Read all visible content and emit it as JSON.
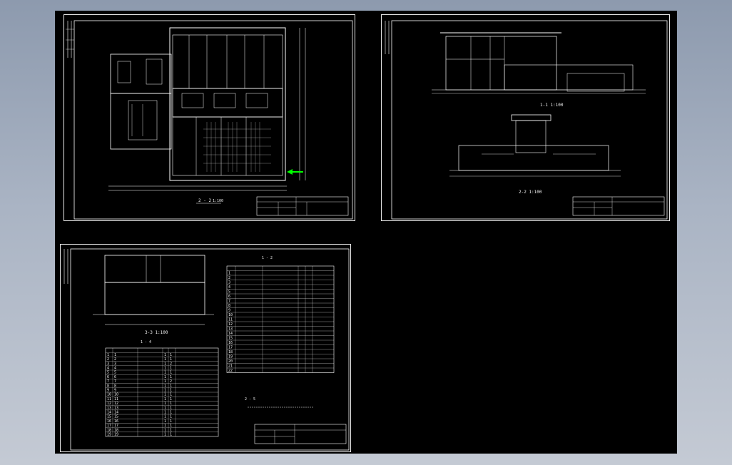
{
  "colors": {
    "background_top": "#8d9aae",
    "background_bottom": "#c4cad4",
    "model_space": "#000000",
    "line_white": "#ffffff",
    "accent_green": "#00ff00"
  },
  "sheets": [
    {
      "title": "2 - 2",
      "scale": "1:100"
    },
    {
      "title": "1-1 1:100",
      "title2": "2-2 1:100"
    },
    {
      "title": "3-3 1:100",
      "list_title_left": "1 - 4",
      "list_title_right": "1 - 2",
      "note": "2 - 5"
    }
  ],
  "table_left": {
    "rows": [
      [
        "1",
        "1",
        "",
        "1",
        "1",
        ""
      ],
      [
        "2",
        "2",
        "",
        "1",
        "1",
        ""
      ],
      [
        "3",
        "3",
        "",
        "1",
        "2",
        ""
      ],
      [
        "4",
        "4",
        "",
        "1",
        "1",
        ""
      ],
      [
        "5",
        "5",
        "",
        "1",
        "1",
        ""
      ],
      [
        "6",
        "6",
        "",
        "1",
        "1",
        ""
      ],
      [
        "7",
        "7",
        "",
        "1",
        "2",
        ""
      ],
      [
        "8",
        "8",
        "",
        "1",
        "1",
        ""
      ],
      [
        "9",
        "9",
        "",
        "1",
        "1",
        ""
      ],
      [
        "10",
        "10",
        "",
        "1",
        "1",
        ""
      ],
      [
        "11",
        "11",
        "",
        "1",
        "1",
        ""
      ],
      [
        "12",
        "12",
        "",
        "1",
        "1",
        ""
      ],
      [
        "13",
        "13",
        "",
        "1",
        "1",
        ""
      ],
      [
        "14",
        "14",
        "",
        "1",
        "1",
        ""
      ],
      [
        "15",
        "15",
        "",
        "1",
        "1",
        ""
      ],
      [
        "16",
        "16",
        "",
        "1",
        "1",
        ""
      ],
      [
        "17",
        "17",
        "",
        "1",
        "1",
        ""
      ],
      [
        "18",
        "18",
        "",
        "1",
        "1",
        ""
      ],
      [
        "19",
        "19",
        "",
        "1",
        "1",
        ""
      ]
    ]
  },
  "table_right": {
    "rows": [
      [
        "1",
        "",
        "",
        "",
        "",
        ""
      ],
      [
        "2",
        "",
        "",
        "",
        "",
        ""
      ],
      [
        "3",
        "",
        "",
        "",
        "",
        ""
      ],
      [
        "4",
        "",
        "",
        "",
        "",
        ""
      ],
      [
        "5",
        "",
        "",
        "",
        "",
        ""
      ],
      [
        "6",
        "",
        "",
        "",
        "",
        ""
      ],
      [
        "7",
        "",
        "",
        "",
        "",
        ""
      ],
      [
        "8",
        "",
        "",
        "",
        "",
        ""
      ],
      [
        "9",
        "",
        "",
        "",
        "",
        ""
      ],
      [
        "10",
        "",
        "",
        "",
        "",
        ""
      ],
      [
        "11",
        "",
        "",
        "",
        "",
        ""
      ],
      [
        "12",
        "",
        "",
        "",
        "",
        ""
      ],
      [
        "13",
        "",
        "",
        "",
        "",
        ""
      ],
      [
        "14",
        "",
        "",
        "",
        "",
        ""
      ],
      [
        "15",
        "",
        "",
        "",
        "",
        ""
      ],
      [
        "16",
        "",
        "",
        "",
        "",
        ""
      ],
      [
        "17",
        "",
        "",
        "",
        "",
        ""
      ],
      [
        "18",
        "",
        "",
        "",
        "",
        ""
      ],
      [
        "19",
        "",
        "",
        "",
        "",
        ""
      ],
      [
        "20",
        "",
        "",
        "",
        "",
        ""
      ],
      [
        "21",
        "",
        "",
        "",
        "",
        ""
      ],
      [
        "22",
        "",
        "",
        "",
        "",
        ""
      ]
    ]
  }
}
